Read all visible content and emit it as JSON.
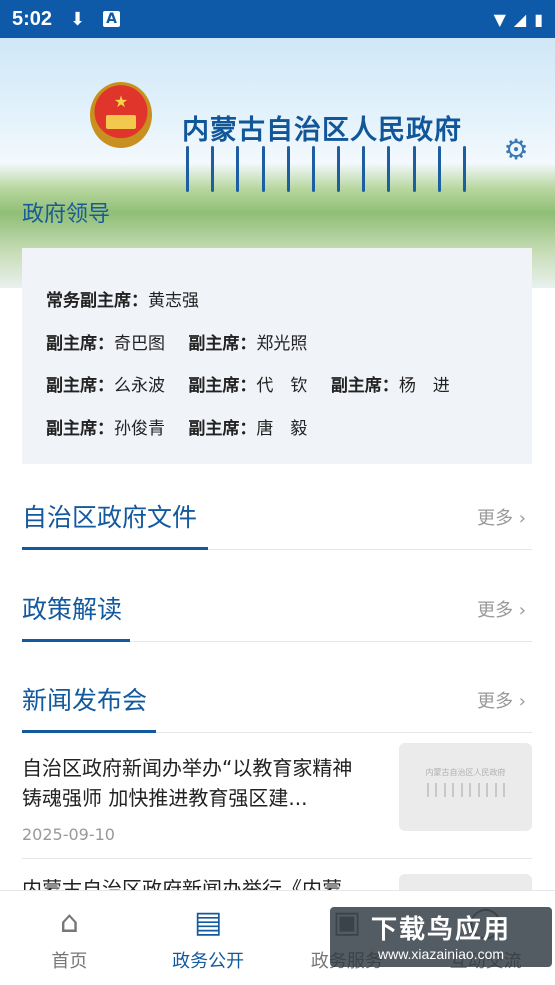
{
  "status_bar": {
    "time": "5:02"
  },
  "header": {
    "title": "内蒙古自治区人民政府"
  },
  "leaders": {
    "section_title": "政府领导",
    "rows": [
      [
        {
          "role": "常务副主席：",
          "name": "黄志强"
        }
      ],
      [
        {
          "role": "副主席：",
          "name": "奇巴图"
        },
        {
          "role": "副主席：",
          "name": "郑光照"
        }
      ],
      [
        {
          "role": "副主席：",
          "name": "么永波"
        },
        {
          "role": "副主席：",
          "name": "代　钦"
        },
        {
          "role": "副主席：",
          "name": "杨　进"
        }
      ],
      [
        {
          "role": "副主席：",
          "name": "孙俊青"
        },
        {
          "role": "副主席：",
          "name": "唐　毅"
        }
      ]
    ]
  },
  "sections": {
    "docs": {
      "title": "自治区政府文件",
      "more": "更多 ›"
    },
    "policy": {
      "title": "政策解读",
      "more": "更多 ›"
    },
    "press": {
      "title": "新闻发布会",
      "more": "更多 ›"
    }
  },
  "news": [
    {
      "headline": "自治区政府新闻办举办“以教育家精神铸魂强师  加快推进教育强区建...",
      "date": "2025-09-10",
      "thumb_text": "内蒙古自治区人民政府"
    },
    {
      "headline": "内蒙古自治区政府新闻办举行《内蒙",
      "date": "",
      "thumb_text": ""
    }
  ],
  "bottom_nav": [
    {
      "label": "首页",
      "icon": "home-icon"
    },
    {
      "label": "政务公开",
      "icon": "documents-icon",
      "active": true
    },
    {
      "label": "政务服务",
      "icon": "service-icon"
    },
    {
      "label": "互动交流",
      "icon": "interaction-icon"
    }
  ],
  "watermark": {
    "line1": "下载鸟应用",
    "line2": "www.xiazainiao.com"
  },
  "colors": {
    "status_bar": "#0f5aa8",
    "accent": "#13599d",
    "card_bg": "#f0f3f8"
  }
}
